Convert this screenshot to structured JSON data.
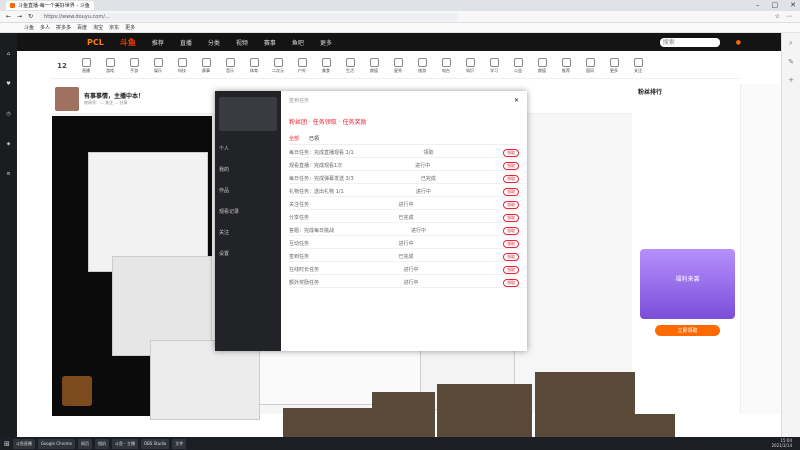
{
  "browser": {
    "tabs": [
      {
        "label": "斗鱼直播-每一个美好世界 - 斗鱼"
      }
    ],
    "url": "https://www.douyu.com/...",
    "bookmarks": [
      "斗鱼",
      "多人",
      "拼多多",
      "百度",
      "淘宝",
      "京东",
      "更多"
    ]
  },
  "site": {
    "brand": "PCL",
    "logo": "斗鱼",
    "nav": [
      "推荐",
      "直播",
      "分类",
      "视频",
      "赛事",
      "鱼吧",
      "更多"
    ],
    "search_placeholder": "搜索",
    "categories": [
      "直播",
      "游戏",
      "手游",
      "娱乐",
      "科技",
      "赛事",
      "音乐",
      "体育",
      "二次元",
      "户外",
      "美食",
      "生活",
      "颜值",
      "星秀",
      "旅游",
      "电台",
      "知识",
      "学习",
      "公益",
      "颜值",
      "推荐",
      "国风",
      "更多",
      "关注"
    ],
    "streamer_name": "有事事情，主播中本！",
    "room_line": "房间号：... 关注 ... 分享",
    "live_count": "12"
  },
  "dialog": {
    "title": "签到任务",
    "sidebar": [
      "个人",
      "我的",
      "作品",
      "观看记录",
      "关注",
      "设置"
    ],
    "heading": "粉丝团 · 任务领取 · 任务奖励",
    "tabs": [
      "全部",
      "已领"
    ],
    "rows": [
      {
        "name": "每日任务：完成直播观看 1/1",
        "status": "领取",
        "btn": "领取"
      },
      {
        "name": "观看直播：完成观看1次",
        "status": "进行中",
        "btn": "领取"
      },
      {
        "name": "每日任务：完成弹幕发送 3/3",
        "status": "已完成",
        "btn": "领取"
      },
      {
        "name": "礼物任务：送出礼物 1/1",
        "status": "进行中",
        "btn": "领取"
      },
      {
        "name": "关注任务",
        "status": "进行中",
        "btn": "领取"
      },
      {
        "name": "分享任务",
        "status": "已完成",
        "btn": "领取"
      },
      {
        "name": "答题：完成每日挑战",
        "status": "进行中",
        "btn": "领取"
      },
      {
        "name": "互动任务",
        "status": "进行中",
        "btn": "领取"
      },
      {
        "name": "签到任务",
        "status": "已完成",
        "btn": "领取"
      },
      {
        "name": "在线时长任务",
        "status": "进行中",
        "btn": "领取"
      },
      {
        "name": "额外奖励任务",
        "status": "进行中",
        "btn": "领取"
      }
    ]
  },
  "rightpanel": {
    "title": "粉丝排行",
    "promo": "福利来袭",
    "cta": "立即领取"
  },
  "taskbar": {
    "items": [
      "斗鱼直播",
      "Google Chrome",
      "网页",
      "相机",
      "斗鱼 - 主播",
      "OBS Studio",
      "文件"
    ],
    "time": "15:04",
    "date": "2021/3/14"
  },
  "colors": {
    "accent": "#ff6a00",
    "dark": "#141414"
  }
}
